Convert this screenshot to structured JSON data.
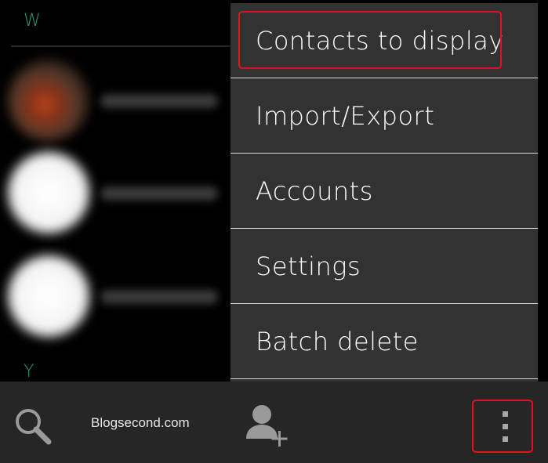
{
  "contacts_list": {
    "section_letters": [
      "W",
      "Y"
    ]
  },
  "overflow_menu": {
    "items": [
      {
        "label": "Contacts to display"
      },
      {
        "label": "Import/Export"
      },
      {
        "label": "Accounts"
      },
      {
        "label": "Settings"
      },
      {
        "label": "Batch delete"
      }
    ]
  },
  "bottom_bar": {
    "watermark": "Blogsecond.com",
    "icons": [
      "search-icon",
      "add-contact-icon",
      "overflow-menu-icon"
    ]
  },
  "colors": {
    "accent_green": "#2e9a72",
    "menu_background": "#323232",
    "highlight_red": "#e0131d",
    "bottom_bar_background": "#262626"
  }
}
